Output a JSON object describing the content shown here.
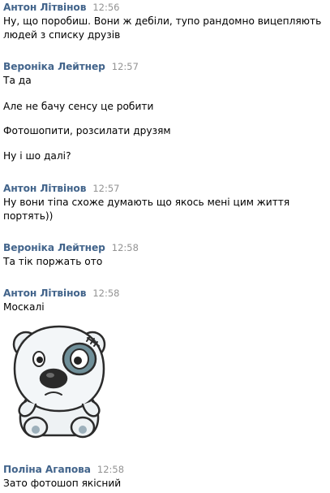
{
  "colors": {
    "author": "#42648b",
    "time": "#939393",
    "text": "#000000"
  },
  "messages": [
    {
      "author": "Антон Літвінов",
      "time": "12:56",
      "lines": [
        "Ну, що поробиш. Вони ж дебіли, тупо рандомно вицепляють",
        "людей з списку друзів"
      ]
    },
    {
      "author": "Вероніка Лейтнер",
      "time": "12:57",
      "lines": [
        "Та да",
        "Але не бачу сенсу це робити",
        "Фотошопити, розсилати друзям",
        "Ну і шо далі?"
      ]
    },
    {
      "author": "Антон Літвінов",
      "time": "12:57",
      "lines": [
        "Ну вони тіпа схоже думають що якось мені цим життя",
        "портять))"
      ]
    },
    {
      "author": "Вероніка Лейтнер",
      "time": "12:58",
      "lines": [
        "Та тік поржать ото"
      ]
    },
    {
      "author": "Антон Літвінов",
      "time": "12:58",
      "lines": [
        "Москалі"
      ],
      "sticker": "white-bear-sticker"
    },
    {
      "author": "Поліна Агапова",
      "time": "12:58",
      "lines": [
        "Зато фотошоп якісний"
      ]
    }
  ]
}
